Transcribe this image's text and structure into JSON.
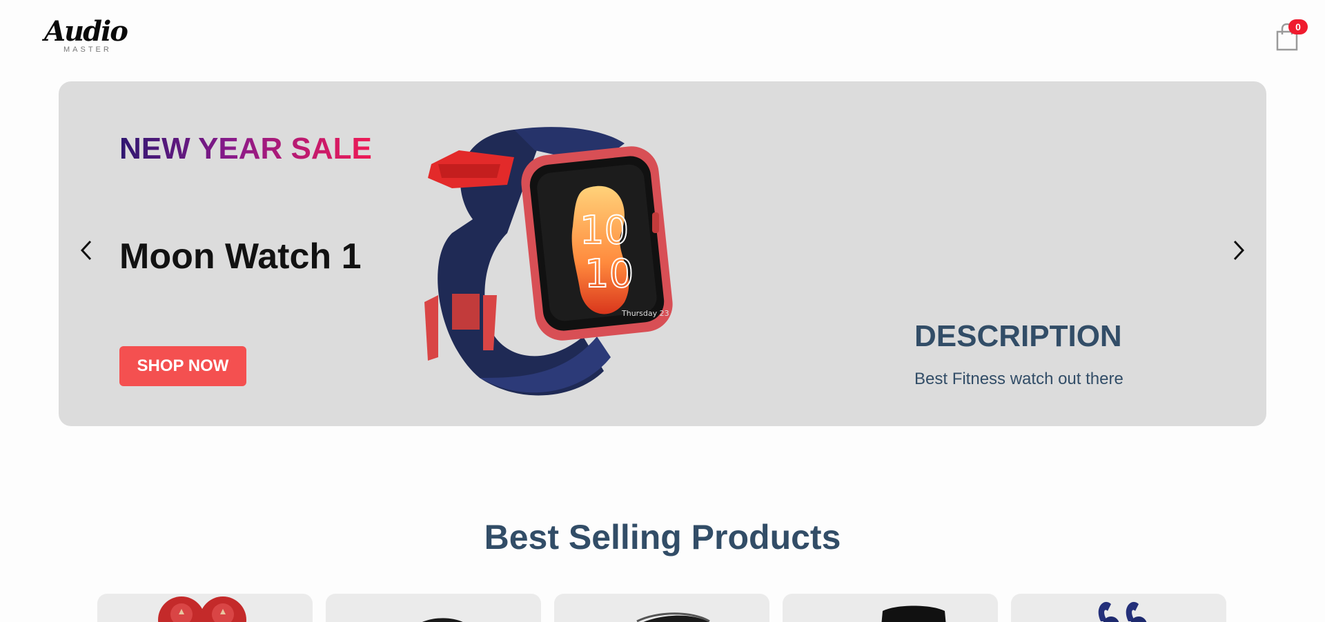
{
  "header": {
    "logo_main": "Audio",
    "logo_sub": "MASTER",
    "cart_count": "0"
  },
  "banner": {
    "small_text": "NEW YEAR SALE",
    "mid_text": "Moon Watch 1",
    "button_text": "SHOP NOW",
    "desc_title": "DESCRIPTION",
    "desc_text": "Best Fitness watch out there",
    "watch_time_hour": "10",
    "watch_time_min": "10",
    "watch_date": "Thursday 23"
  },
  "best_selling": {
    "title": "Best Selling Products",
    "products": [
      {
        "icon": "red-earbuds-image"
      },
      {
        "icon": "black-headphones-image"
      },
      {
        "icon": "black-speaker-image"
      },
      {
        "icon": "black-headphones-image"
      },
      {
        "icon": "blue-earphones-image"
      }
    ]
  },
  "colors": {
    "banner_bg": "#dcdcdc",
    "accent_red": "#f45050",
    "heading_blue": "#324d67",
    "badge_red": "#ef1b2e"
  }
}
